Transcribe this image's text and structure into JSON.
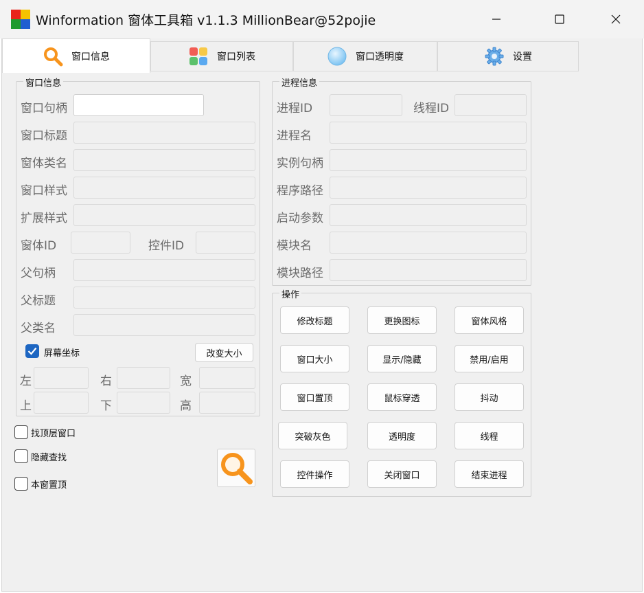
{
  "window": {
    "title": "Winformation 窗体工具箱 v1.1.3  MillionBear@52pojie"
  },
  "tabs": [
    {
      "label": "窗口信息",
      "icon": "magnifier-icon",
      "active": true
    },
    {
      "label": "窗口列表",
      "icon": "colorful-grid-icon",
      "active": false
    },
    {
      "label": "窗口透明度",
      "icon": "bubble-icon",
      "active": false
    },
    {
      "label": "设置",
      "icon": "gear-icon",
      "active": false
    }
  ],
  "window_info": {
    "title": "窗口信息",
    "handle_label": "窗口句柄",
    "title_label": "窗口标题",
    "class_label": "窗体类名",
    "style_label": "窗口样式",
    "exstyle_label": "扩展样式",
    "form_id_label": "窗体ID",
    "control_id_label": "控件ID",
    "parent_handle_label": "父句柄",
    "parent_title_label": "父标题",
    "parent_class_label": "父类名",
    "screen_coords_label": "屏幕坐标",
    "screen_coords_checked": true,
    "resize_button": "改变大小",
    "left_label": "左",
    "right_label": "右",
    "width_label": "宽",
    "top_label": "上",
    "bottom_label": "下",
    "height_label": "高"
  },
  "process_info": {
    "title": "进程信息",
    "pid_label": "进程ID",
    "tid_label": "线程ID",
    "name_label": "进程名",
    "instance_label": "实例句柄",
    "path_label": "程序路径",
    "args_label": "启动参数",
    "module_label": "模块名",
    "module_path_label": "模块路径"
  },
  "operations": {
    "title": "操作",
    "buttons": [
      "修改标题",
      "更换图标",
      "窗体风格",
      "窗口大小",
      "显示/隐藏",
      "禁用/启用",
      "窗口置顶",
      "鼠标穿透",
      "抖动",
      "突破灰色",
      "透明度",
      "线程",
      "控件操作",
      "关闭窗口",
      "结束进程"
    ]
  },
  "options": {
    "find_top_label": "找顶层窗口",
    "hide_find_label": "隐藏查找",
    "topmost_label": "本窗置顶"
  },
  "colors": {
    "accent": "#1d66c2",
    "magnifier": "#f7941d"
  }
}
